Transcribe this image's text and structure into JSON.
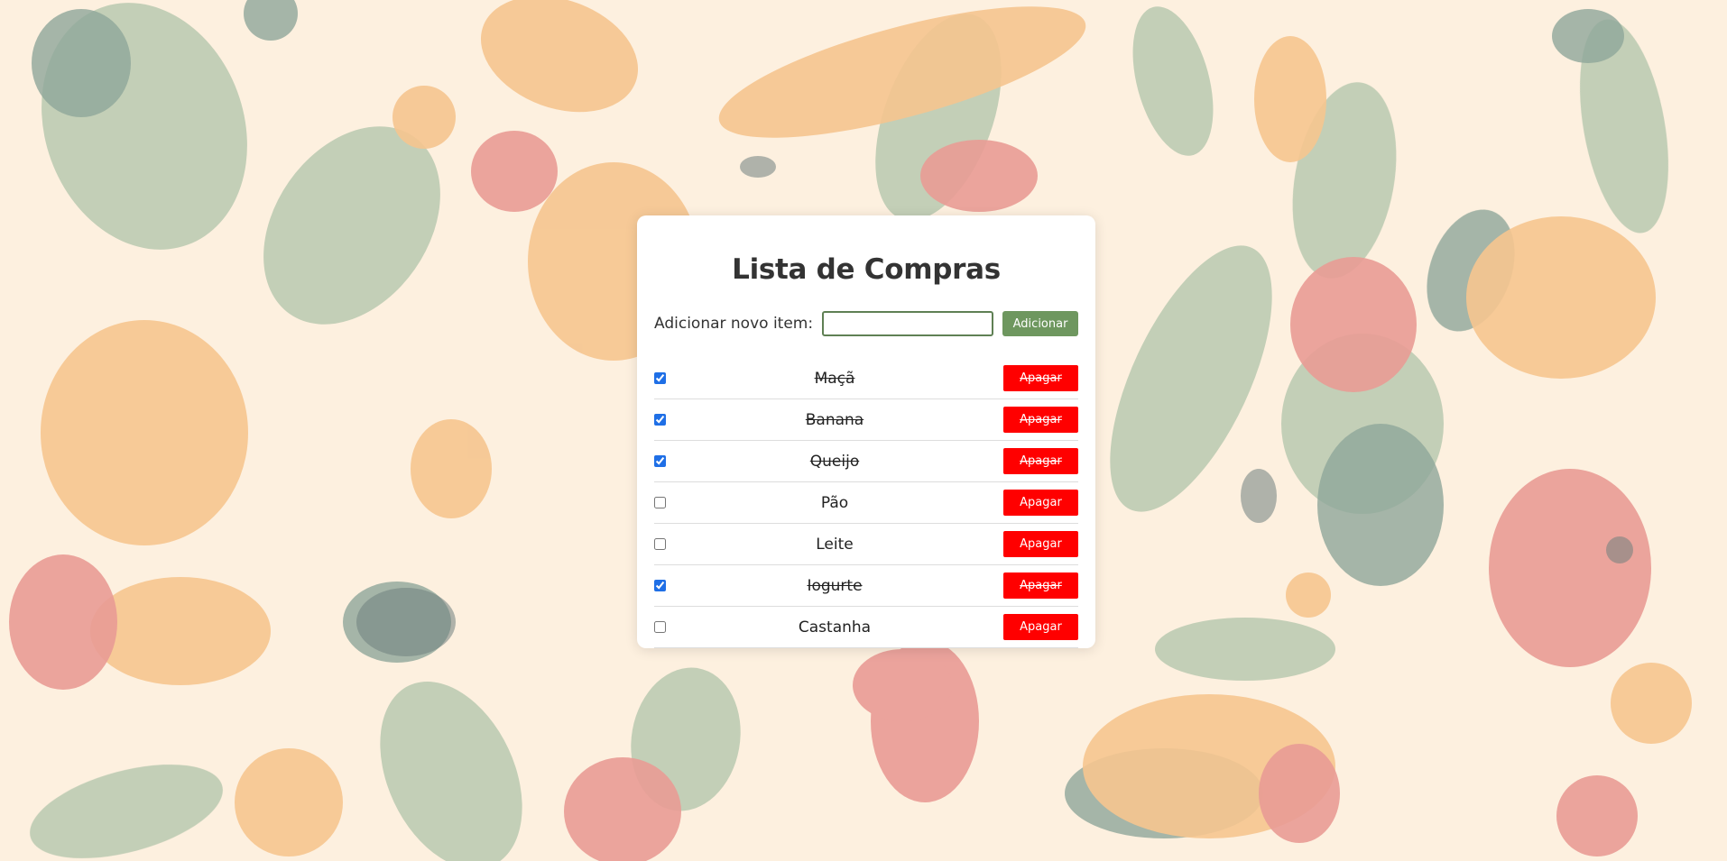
{
  "page": {
    "title": "Lista de Compras"
  },
  "add_form": {
    "label": "Adicionar novo item:",
    "input_value": "",
    "button_label": "Adicionar"
  },
  "items": [
    {
      "name": "Maçã",
      "checked": true,
      "delete_label": "Apagar"
    },
    {
      "name": "Banana",
      "checked": true,
      "delete_label": "Apagar"
    },
    {
      "name": "Queijo",
      "checked": true,
      "delete_label": "Apagar"
    },
    {
      "name": "Pão",
      "checked": false,
      "delete_label": "Apagar"
    },
    {
      "name": "Leite",
      "checked": false,
      "delete_label": "Apagar"
    },
    {
      "name": "Iogurte",
      "checked": true,
      "delete_label": "Apagar"
    },
    {
      "name": "Castanha",
      "checked": false,
      "delete_label": "Apagar"
    }
  ],
  "colors": {
    "background": "#fdf0df",
    "add_button": "#6e975f",
    "delete_button": "#ff0000",
    "input_border": "#5f8054"
  },
  "background_illustration": "food-pattern-illustration"
}
